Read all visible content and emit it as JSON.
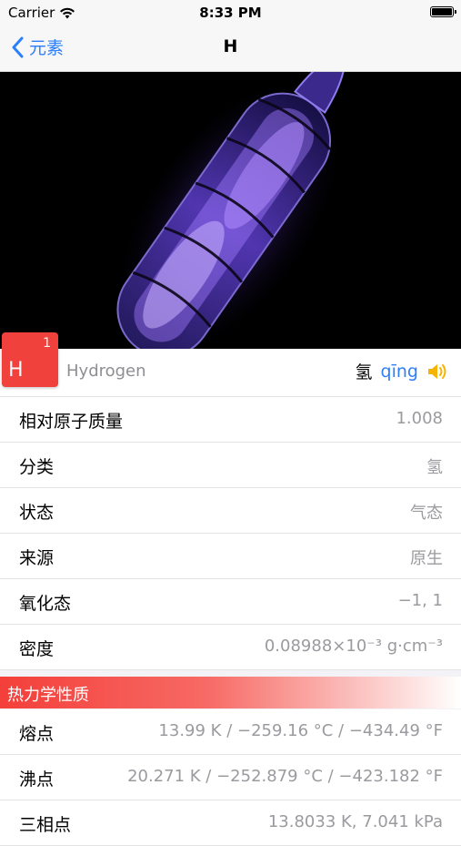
{
  "status": {
    "carrier": "Carrier",
    "time": "8:33 PM"
  },
  "nav": {
    "back_label": "元素",
    "title": "H"
  },
  "element": {
    "symbol": "H",
    "atomic_number": "1",
    "name_en": "Hydrogen",
    "hanzi": "氢",
    "pinyin": "qīng",
    "tile_color": "#f0413c"
  },
  "properties": [
    {
      "label": "相对原子质量",
      "value": "1.008"
    },
    {
      "label": "分类",
      "value": "氢"
    },
    {
      "label": "状态",
      "value": "气态"
    },
    {
      "label": "来源",
      "value": "原生"
    },
    {
      "label": "氧化态",
      "value": "−1, 1"
    },
    {
      "label": "密度",
      "value": "0.08988×10⁻³ g·cm⁻³"
    }
  ],
  "thermo": {
    "title": "热力学性质",
    "rows": [
      {
        "label": "熔点",
        "value": "13.99 K / −259.16 °C / −434.49 °F"
      },
      {
        "label": "沸点",
        "value": "20.271 K / −252.879 °C / −423.182 °F"
      },
      {
        "label": "三相点",
        "value": "13.8033 K, 7.041 kPa"
      }
    ]
  },
  "icons": {
    "back": "chevron-left-icon",
    "speaker": "speaker-icon",
    "wifi": "wifi-icon",
    "battery": "battery-icon"
  }
}
